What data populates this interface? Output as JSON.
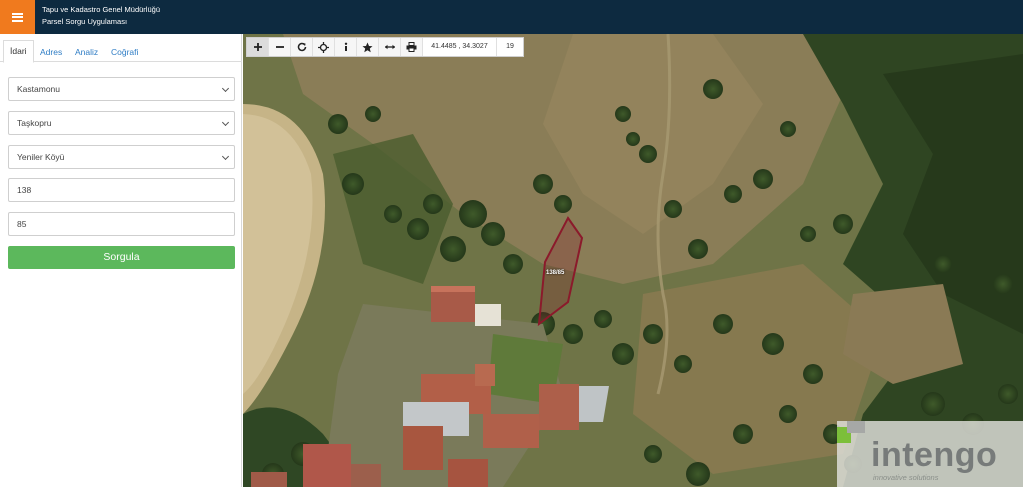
{
  "header": {
    "title_line1": "Tapu ve Kadastro Genel Müdürlüğü",
    "title_line2": "Parsel Sorgu Uygulaması",
    "menu_icon": "hamburger-icon",
    "accent_color": "#f07a1e",
    "bar_color": "#0d2a40"
  },
  "sidebar": {
    "tabs": [
      {
        "label": "İdari",
        "active": true
      },
      {
        "label": "Adres",
        "active": false
      },
      {
        "label": "Analiz",
        "active": false
      },
      {
        "label": "Coğrafi",
        "active": false
      }
    ],
    "province": "Kastamonu",
    "district": "Taşkopru",
    "neighbourhood": "Yeniler Köyü",
    "block_no": "138",
    "parcel_no": "85",
    "query_button": "Sorgula",
    "button_color": "#5cb85c"
  },
  "map": {
    "toolbar": {
      "tools": [
        "zoom-in-icon",
        "zoom-out-icon",
        "refresh-icon",
        "locate-icon",
        "info-icon",
        "star-icon",
        "measure-icon",
        "print-icon"
      ],
      "coordinates": "41.4485 , 34.3027",
      "zoom_level": "19"
    },
    "parcel_label": "138/85",
    "parcel_outline_color": "#8b1a2b",
    "logo": {
      "name": "intengo",
      "tagline": "innovative solutions"
    }
  }
}
